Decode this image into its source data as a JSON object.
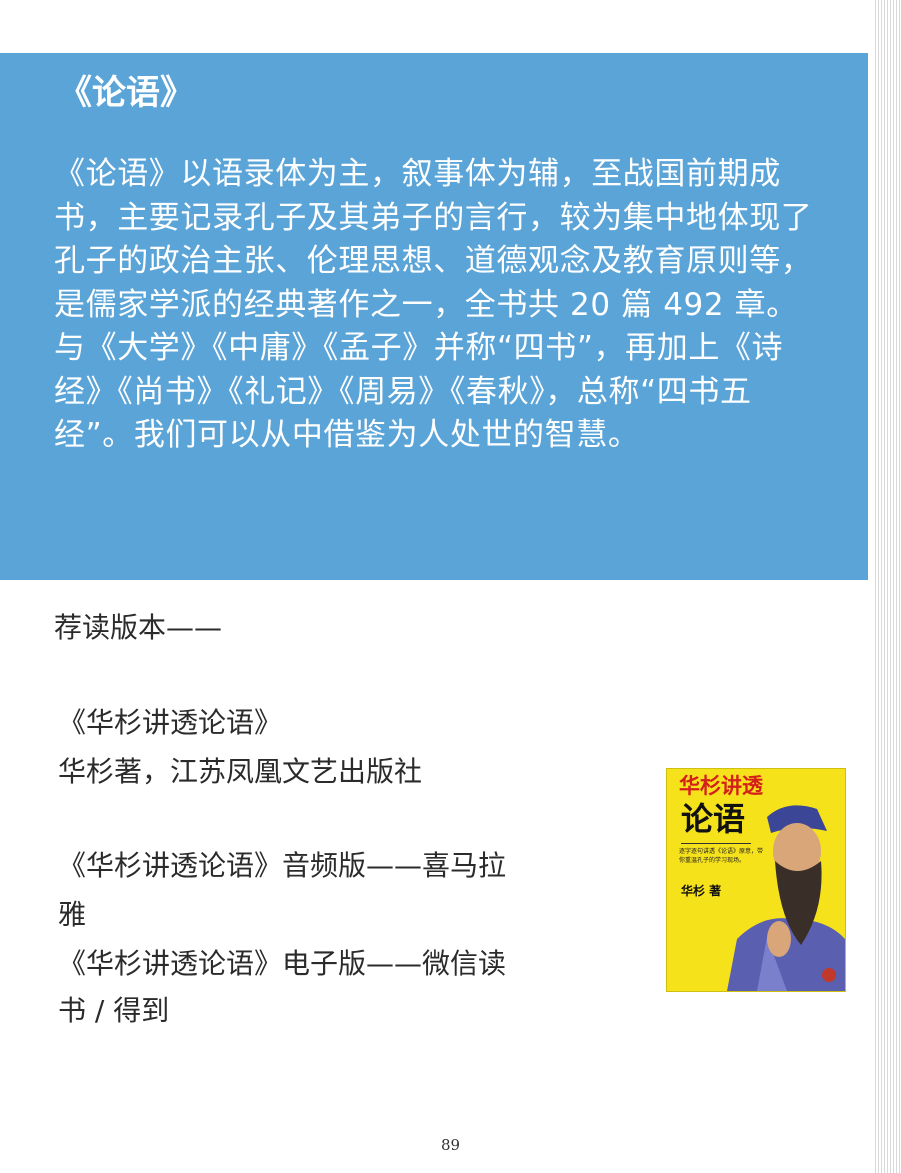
{
  "panel": {
    "title": "《论语》",
    "body": "《论语》以语录体为主，叙事体为辅，至战国前期成书，主要记录孔子及其弟子的言行，较为集中地体现了孔子的政治主张、伦理思想、道德观念及教育原则等，是儒家学派的经典著作之一，全书共 20 篇 492 章。与《大学》《中庸》《孟子》并称“四书”，再加上《诗经》《尚书》《礼记》《周易》《春秋》，总称“四书五经”。我们可以从中借鉴为人处世的智慧。"
  },
  "recommend": {
    "heading": "荐读版本——",
    "lines": [
      "《华杉讲透论语》",
      "华杉著，江苏凤凰文艺出版社",
      "《华杉讲透论语》音频版——喜马拉",
      "雅",
      "《华杉讲透论语》电子版——微信读",
      "书 / 得到"
    ]
  },
  "book_cover": {
    "title_top": "华杉讲透",
    "title_main": "论语",
    "blurb": "逐字逐句讲透《论语》原意，带你重温孔子的学习现场。",
    "author": "华杉 著",
    "colors": {
      "background": "#f6e21b",
      "title": "#d4201a",
      "robe": "#5a5fb0"
    }
  },
  "page_number": "89",
  "colors": {
    "panel": "#5ba4d8",
    "panel_text": "#ffffff",
    "text": "#2b2b2b"
  }
}
